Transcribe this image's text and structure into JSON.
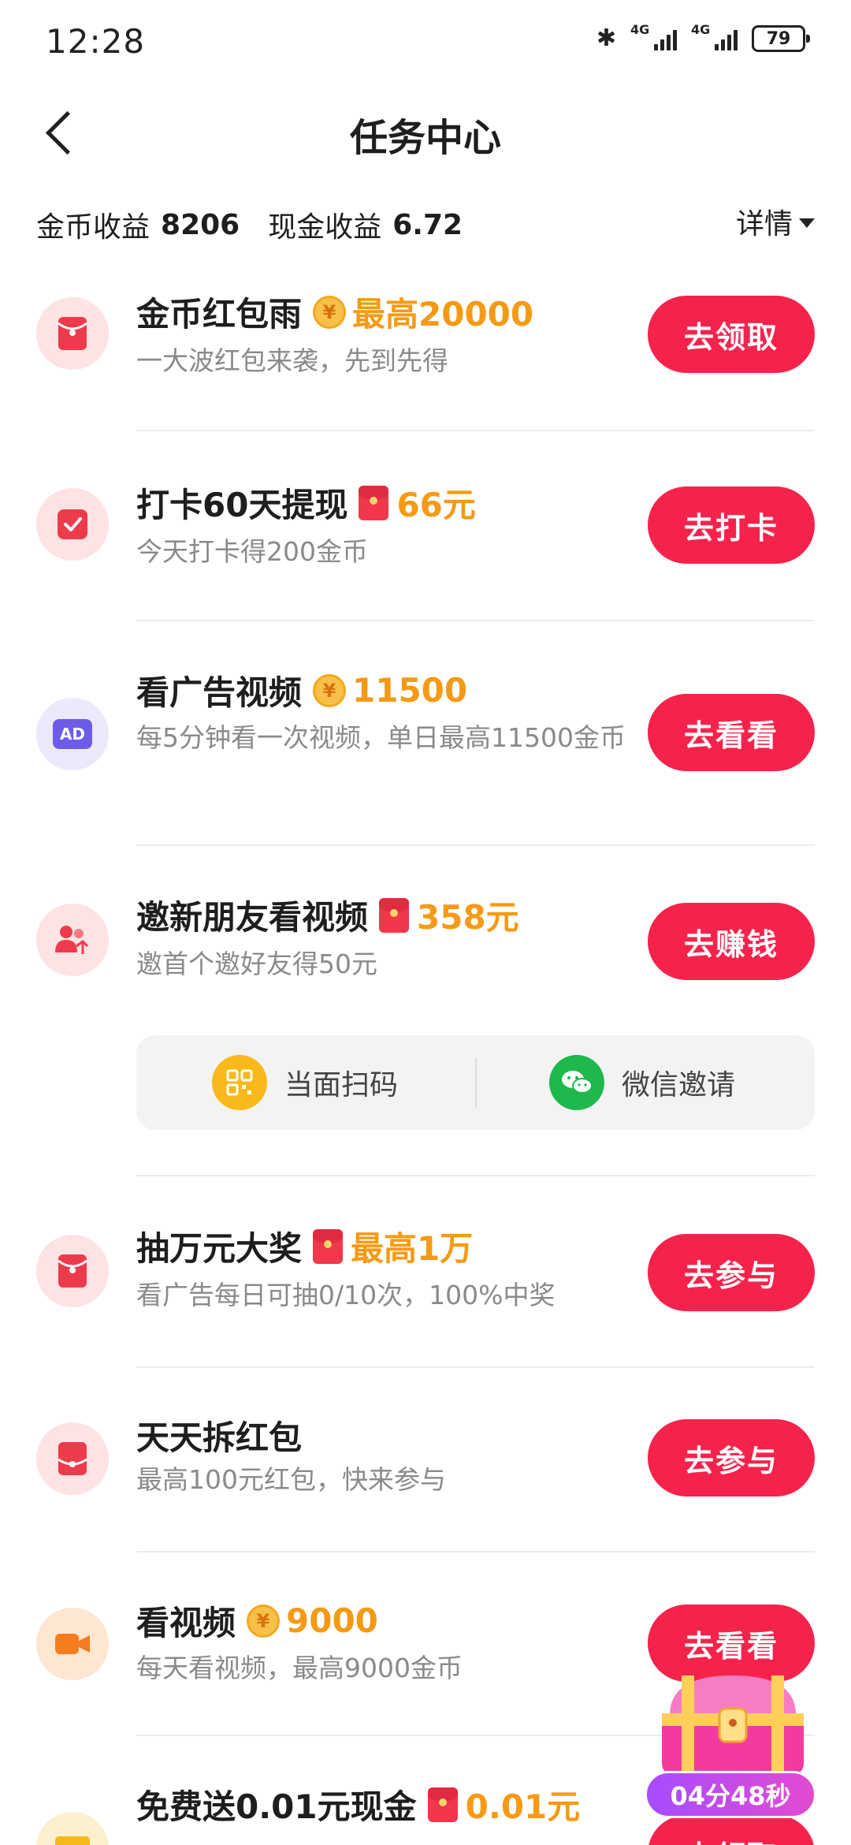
{
  "status_bar": {
    "time": "12:28",
    "network1": "4G",
    "network2": "4G",
    "battery": "79"
  },
  "header": {
    "title": "任务中心"
  },
  "earnings": {
    "coin_label": "金币收益",
    "coin_value": "8206",
    "cash_label": "现金收益",
    "cash_value": "6.72",
    "detail_label": "详情"
  },
  "tasks": [
    {
      "title": "金币红包雨",
      "reward_icon": "coin-icon",
      "reward": "最高20000",
      "desc": "一大波红包来袭，先到先得",
      "button": "去领取"
    },
    {
      "title": "打卡60天提现",
      "reward_icon": "red-packet-icon",
      "reward": "66元",
      "desc": "今天打卡得200金币",
      "button": "去打卡"
    },
    {
      "title": "看广告视频",
      "reward_icon": "coin-icon",
      "reward": "11500",
      "desc": "每5分钟看一次视频，单日最高11500金币",
      "button": "去看看"
    },
    {
      "title": "邀新朋友看视频",
      "reward_icon": "red-packet-icon",
      "reward": "358元",
      "desc": "邀首个邀好友得50元",
      "button": "去赚钱"
    },
    {
      "title": "抽万元大奖",
      "reward_icon": "red-packet-icon",
      "reward": "最高1万",
      "desc": "看广告每日可抽0/10次，100%中奖",
      "button": "去参与"
    },
    {
      "title": "天天拆红包",
      "reward_icon": "",
      "reward": "",
      "desc": "最高100元红包，快来参与",
      "button": "去参与"
    },
    {
      "title": "看视频",
      "reward_icon": "coin-icon",
      "reward": "9000",
      "desc": "每天看视频，最高9000金币",
      "button": "去看看"
    },
    {
      "title": "免费送0.01元现金",
      "reward_icon": "red-packet-icon",
      "reward": "0.01元",
      "desc": "",
      "button": "去领取"
    }
  ],
  "invite_options": {
    "scan": "当面扫码",
    "wechat": "微信邀请"
  },
  "coin_symbol": "¥",
  "ad_badge": "AD",
  "floating_timer": "04分48秒",
  "colors": {
    "accent": "#f5234c",
    "reward": "#f59a15",
    "timer": "#b64cf0"
  }
}
